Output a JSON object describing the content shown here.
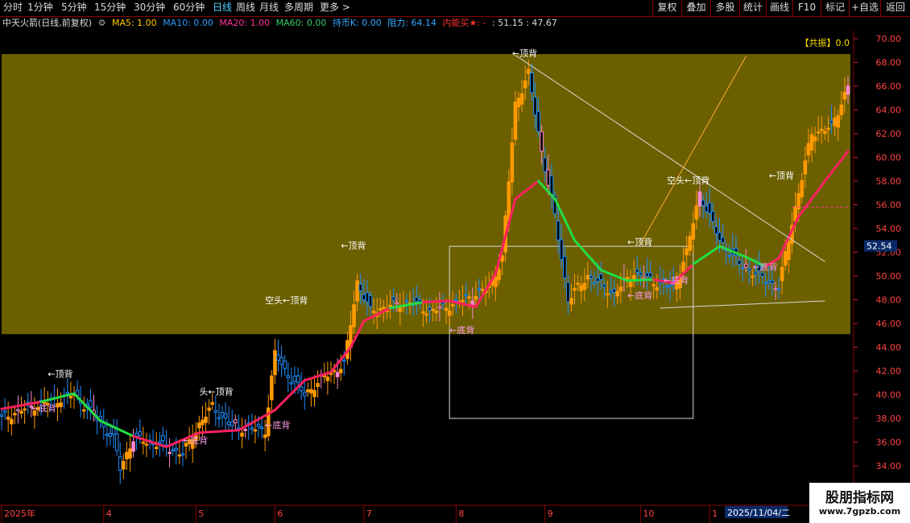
{
  "toolbar": {
    "periods": [
      "分时",
      "1分钟",
      "5分钟",
      "15分钟",
      "30分钟",
      "60分钟",
      "日线",
      "周线",
      "月线",
      "多周期",
      "更多 >"
    ],
    "active_period": "日线",
    "buttons": [
      "复权",
      "叠加",
      "多股",
      "统计",
      "画线",
      "F10",
      "标记",
      "+自选",
      "返回"
    ]
  },
  "info": {
    "title": "中天火箭(日线,前复权)",
    "ma5": "MA5: 1.00",
    "ma10": "MA10: 0.00",
    "ma20": "MA20: 1.00",
    "ma60": "MA60: 0.00",
    "hold": "持币K: 0.00",
    "resist": "阻力: 64.14",
    "inner": "内能买★: -",
    "vals": ": 51.15 : 47.67"
  },
  "resonance_label": "【共振】0.0",
  "price_tag": "52.54",
  "date_cursor": "2025/11/04/二",
  "colors": {
    "up": "#ff9900",
    "down": "#1e90ff",
    "band": "#6b5f00",
    "ma_up": "#ff2060",
    "ma_down": "#22dd44",
    "pink": "#ff88cc"
  },
  "watermark": {
    "line1": "股朋指标网",
    "line2": "www.7gpzb.com"
  },
  "chart_data": {
    "type": "candlestick",
    "title": "中天火箭(日线,前复权)",
    "y_ticks": [
      34,
      36,
      38,
      40,
      42,
      44,
      46,
      48,
      50,
      52,
      54,
      56,
      58,
      60,
      62,
      64,
      66,
      68,
      70
    ],
    "ylim": [
      33.2,
      71.0
    ],
    "x_labels": [
      {
        "label": "2025年",
        "day": 0
      },
      {
        "label": "4",
        "day": 31
      },
      {
        "label": "5",
        "day": 59
      },
      {
        "label": "6",
        "day": 83
      },
      {
        "label": "7",
        "day": 110
      },
      {
        "label": "8",
        "day": 138
      },
      {
        "label": "9",
        "day": 165
      },
      {
        "label": "10",
        "day": 194
      },
      {
        "label": "1",
        "day": 215
      }
    ],
    "days": 258,
    "band": [
      45.1,
      68.7
    ],
    "close_points": [
      [
        0,
        38.0
      ],
      [
        8,
        38.9
      ],
      [
        16,
        39.5
      ],
      [
        22,
        40.0
      ],
      [
        28,
        38.3
      ],
      [
        34,
        36.3
      ],
      [
        36,
        33.8
      ],
      [
        40,
        36.3
      ],
      [
        48,
        35.8
      ],
      [
        55,
        35.0
      ],
      [
        60,
        37.5
      ],
      [
        64,
        39.0
      ],
      [
        70,
        37.3
      ],
      [
        80,
        37.0
      ],
      [
        83,
        43.5
      ],
      [
        86,
        42.0
      ],
      [
        92,
        40.0
      ],
      [
        98,
        41.5
      ],
      [
        104,
        42.5
      ],
      [
        108,
        49.5
      ],
      [
        112,
        47.0
      ],
      [
        118,
        47.5
      ],
      [
        124,
        47.8
      ],
      [
        130,
        47.0
      ],
      [
        136,
        47.5
      ],
      [
        142,
        48.2
      ],
      [
        148,
        49.0
      ],
      [
        152,
        51.5
      ],
      [
        156,
        64.5
      ],
      [
        160,
        67.0
      ],
      [
        164,
        60.5
      ],
      [
        168,
        55.0
      ],
      [
        172,
        48.0
      ],
      [
        178,
        50.0
      ],
      [
        186,
        48.5
      ],
      [
        192,
        50.3
      ],
      [
        198,
        49.5
      ],
      [
        204,
        49.0
      ],
      [
        208,
        52.0
      ],
      [
        212,
        57.0
      ],
      [
        218,
        53.0
      ],
      [
        224,
        51.0
      ],
      [
        230,
        50.0
      ],
      [
        236,
        49.0
      ],
      [
        240,
        54.5
      ],
      [
        246,
        62.0
      ],
      [
        252,
        62.5
      ],
      [
        257,
        66.0
      ]
    ],
    "ma_points": [
      [
        0,
        38.8,
        0
      ],
      [
        12,
        39.4,
        1
      ],
      [
        22,
        40.1,
        0
      ],
      [
        30,
        37.8,
        0
      ],
      [
        40,
        36.5,
        0
      ],
      [
        50,
        35.6,
        1
      ],
      [
        60,
        36.8,
        1
      ],
      [
        72,
        37.0,
        1
      ],
      [
        83,
        38.7,
        1
      ],
      [
        92,
        41.2,
        1
      ],
      [
        100,
        41.9,
        1
      ],
      [
        106,
        44.0,
        1
      ],
      [
        110,
        46.2,
        1
      ],
      [
        118,
        47.3,
        1
      ],
      [
        128,
        47.8,
        0
      ],
      [
        136,
        47.9,
        1
      ],
      [
        144,
        47.4,
        1
      ],
      [
        150,
        50.2,
        1
      ],
      [
        156,
        56.5,
        1
      ],
      [
        163,
        58.0,
        1
      ],
      [
        168,
        56.5,
        0
      ],
      [
        174,
        53.0,
        0
      ],
      [
        182,
        50.5,
        0
      ],
      [
        190,
        49.6,
        0
      ],
      [
        198,
        49.7,
        0
      ],
      [
        204,
        49.4,
        1
      ],
      [
        210,
        51.0,
        1
      ],
      [
        218,
        52.5,
        0
      ],
      [
        226,
        51.6,
        0
      ],
      [
        232,
        50.8,
        0
      ],
      [
        236,
        51.5,
        1
      ],
      [
        242,
        55.0,
        1
      ],
      [
        250,
        58.0,
        1
      ],
      [
        257,
        60.5,
        1
      ]
    ],
    "annotations": [
      {
        "text": "←顶背",
        "day": 14,
        "price": 41.5
      },
      {
        "text": "←底背",
        "day": 9,
        "price": 38.6
      },
      {
        "text": "头←顶背",
        "day": 60,
        "price": 40.0
      },
      {
        "text": "←底背",
        "day": 55,
        "price": 35.9
      },
      {
        "text": "←底背",
        "day": 80,
        "price": 37.2
      },
      {
        "text": "空头←顶背",
        "day": 80,
        "price": 47.7
      },
      {
        "text": "←顶背",
        "day": 103,
        "price": 52.3
      },
      {
        "text": "←顶背",
        "day": 155,
        "price": 68.5
      },
      {
        "text": "←底背",
        "day": 136,
        "price": 45.2
      },
      {
        "text": "←顶背",
        "day": 190,
        "price": 52.6
      },
      {
        "text": "←底背",
        "day": 190,
        "price": 48.1
      },
      {
        "text": "←底背",
        "day": 201,
        "price": 49.4
      },
      {
        "text": "空头←顶背",
        "day": 202,
        "price": 57.8
      },
      {
        "text": "←底背",
        "day": 228,
        "price": 50.5
      },
      {
        "text": "←顶背",
        "day": 233,
        "price": 58.2
      }
    ],
    "lines": [
      {
        "from": [
          156,
          68.6
        ],
        "to": [
          250,
          51.2
        ],
        "color": "#d8d8d8"
      },
      {
        "from": [
          194,
          52.7
        ],
        "to": [
          226,
          68.5
        ],
        "color": "#ffaa33"
      },
      {
        "from": [
          200,
          47.3
        ],
        "to": [
          250,
          47.9
        ],
        "color": "#d8d8d8"
      }
    ],
    "rectangle": {
      "from": [
        136,
        52.5
      ],
      "to": [
        210,
        38.0
      ]
    }
  }
}
